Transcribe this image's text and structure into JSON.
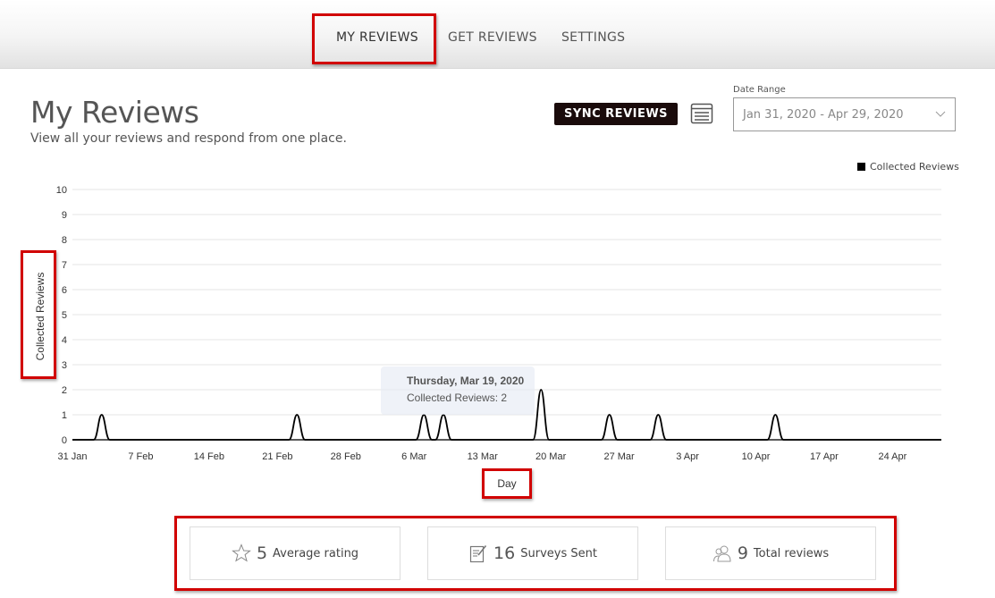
{
  "nav": {
    "tabs": [
      {
        "label": "MY REVIEWS",
        "active": true
      },
      {
        "label": "GET REVIEWS",
        "active": false
      },
      {
        "label": "SETTINGS",
        "active": false
      }
    ]
  },
  "header": {
    "title": "My Reviews",
    "subtitle": "View all your reviews and respond from one place.",
    "sync_label": "SYNC REVIEWS",
    "date_range_label": "Date Range",
    "date_range_value": "Jan 31, 2020 - Apr 29, 2020"
  },
  "colors": {
    "highlight_border": "#d10000",
    "sync_button_bg": "#1a0b0b",
    "series_line": "#000000"
  },
  "chart_data": {
    "type": "line",
    "ylabel": "Collected Reviews",
    "xlabel": "Day",
    "ylim": [
      0,
      10
    ],
    "yticks": [
      0,
      1,
      2,
      3,
      4,
      5,
      6,
      7,
      8,
      9,
      10
    ],
    "xlim": [
      "2020-01-31",
      "2020-04-29"
    ],
    "xtick_labels": [
      "31 Jan",
      "7 Feb",
      "14 Feb",
      "21 Feb",
      "28 Feb",
      "6 Mar",
      "13 Mar",
      "20 Mar",
      "27 Mar",
      "3 Apr",
      "10 Apr",
      "17 Apr",
      "24 Apr"
    ],
    "legend_position": "top-right",
    "grid": true,
    "series": [
      {
        "name": "Collected Reviews",
        "points": [
          {
            "date": "2020-02-03",
            "value": 1
          },
          {
            "date": "2020-02-23",
            "value": 1
          },
          {
            "date": "2020-03-07",
            "value": 1
          },
          {
            "date": "2020-03-09",
            "value": 1
          },
          {
            "date": "2020-03-19",
            "value": 2
          },
          {
            "date": "2020-03-26",
            "value": 1
          },
          {
            "date": "2020-03-31",
            "value": 1
          },
          {
            "date": "2020-04-12",
            "value": 1
          }
        ]
      }
    ],
    "tooltip": {
      "date": "Thursday, Mar 19, 2020",
      "text": "Collected Reviews: 2"
    }
  },
  "stats": [
    {
      "icon": "star-icon",
      "value": "5",
      "label": "Average rating"
    },
    {
      "icon": "survey-icon",
      "value": "16",
      "label": "Surveys Sent"
    },
    {
      "icon": "users-icon",
      "value": "9",
      "label": "Total reviews"
    }
  ]
}
